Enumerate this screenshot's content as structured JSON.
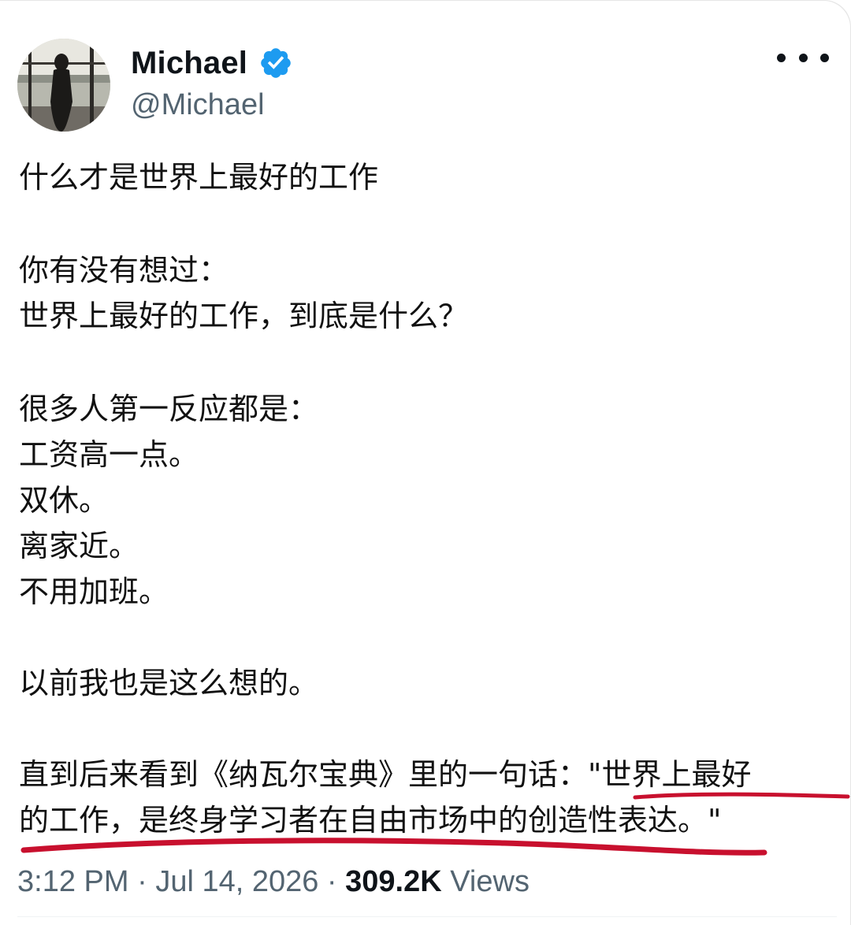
{
  "author": {
    "display_name": "Michael",
    "handle": "@Michael"
  },
  "tweet": {
    "lines": [
      "什么才是世界上最好的工作",
      "你有没有想过：",
      "世界上最好的工作，到底是什么？",
      "很多人第一反应都是：",
      "工资高一点。",
      "双休。",
      "离家近。",
      "不用加班。",
      "以前我也是这么想的。",
      "直到后来看到《纳瓦尔宝典》里的一句话：\"世界上最好",
      "的工作，是终身学习者在自由市场中的创造性表达。\""
    ]
  },
  "meta": {
    "time": "3:12 PM",
    "separator": " · ",
    "date": "Jul 14, 2026",
    "views_count": "309.2K",
    "views_label": " Views"
  },
  "colors": {
    "verified_badge": "#1d9bf0",
    "underline": "#c8102e",
    "secondary_text": "#536471"
  }
}
